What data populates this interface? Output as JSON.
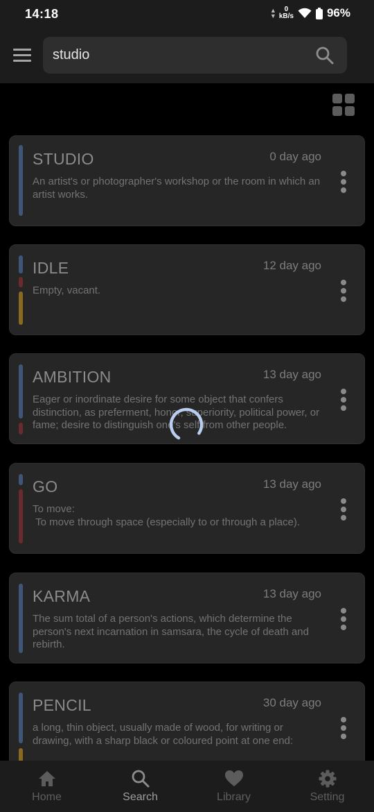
{
  "status_bar": {
    "time": "14:18",
    "net_speed_value": "0",
    "net_speed_unit": "kB/s",
    "battery": "96%"
  },
  "search": {
    "query": "studio"
  },
  "words": [
    {
      "title": "STUDIO",
      "date": "0 day ago",
      "definition": "An artist's or photographer's workshop or the room in which an artist works."
    },
    {
      "title": "IDLE",
      "date": "12 day ago",
      "definition": "Empty, vacant."
    },
    {
      "title": "AMBITION",
      "date": "13 day ago",
      "definition": "Eager or inordinate desire for some object that confers distinction, as preferment, honor, superiority, political power, or fame; desire to distinguish one's self from other people."
    },
    {
      "title": "GO",
      "date": "13 day ago",
      "definition": "To move:\n To move through space (especially to or through a place)."
    },
    {
      "title": "KARMA",
      "date": "13 day ago",
      "definition": "The sum total of a person's actions, which determine the person's next incarnation in samsara, the cycle of death and rebirth."
    },
    {
      "title": "PENCIL",
      "date": "30 day ago",
      "definition": "a long, thin object, usually made of wood, for writing or drawing, with a sharp black or coloured point at one end:"
    }
  ],
  "nav": {
    "home": "Home",
    "search": "Search",
    "library": "Library",
    "setting": "Setting",
    "active": "search"
  },
  "colors": {
    "background": "#000000",
    "card": "#262626",
    "bar_blue": "#3f5678",
    "bar_red": "#6b2a2d",
    "bar_yellow": "#8a6a1e",
    "spinner": "#b9cdf0"
  }
}
